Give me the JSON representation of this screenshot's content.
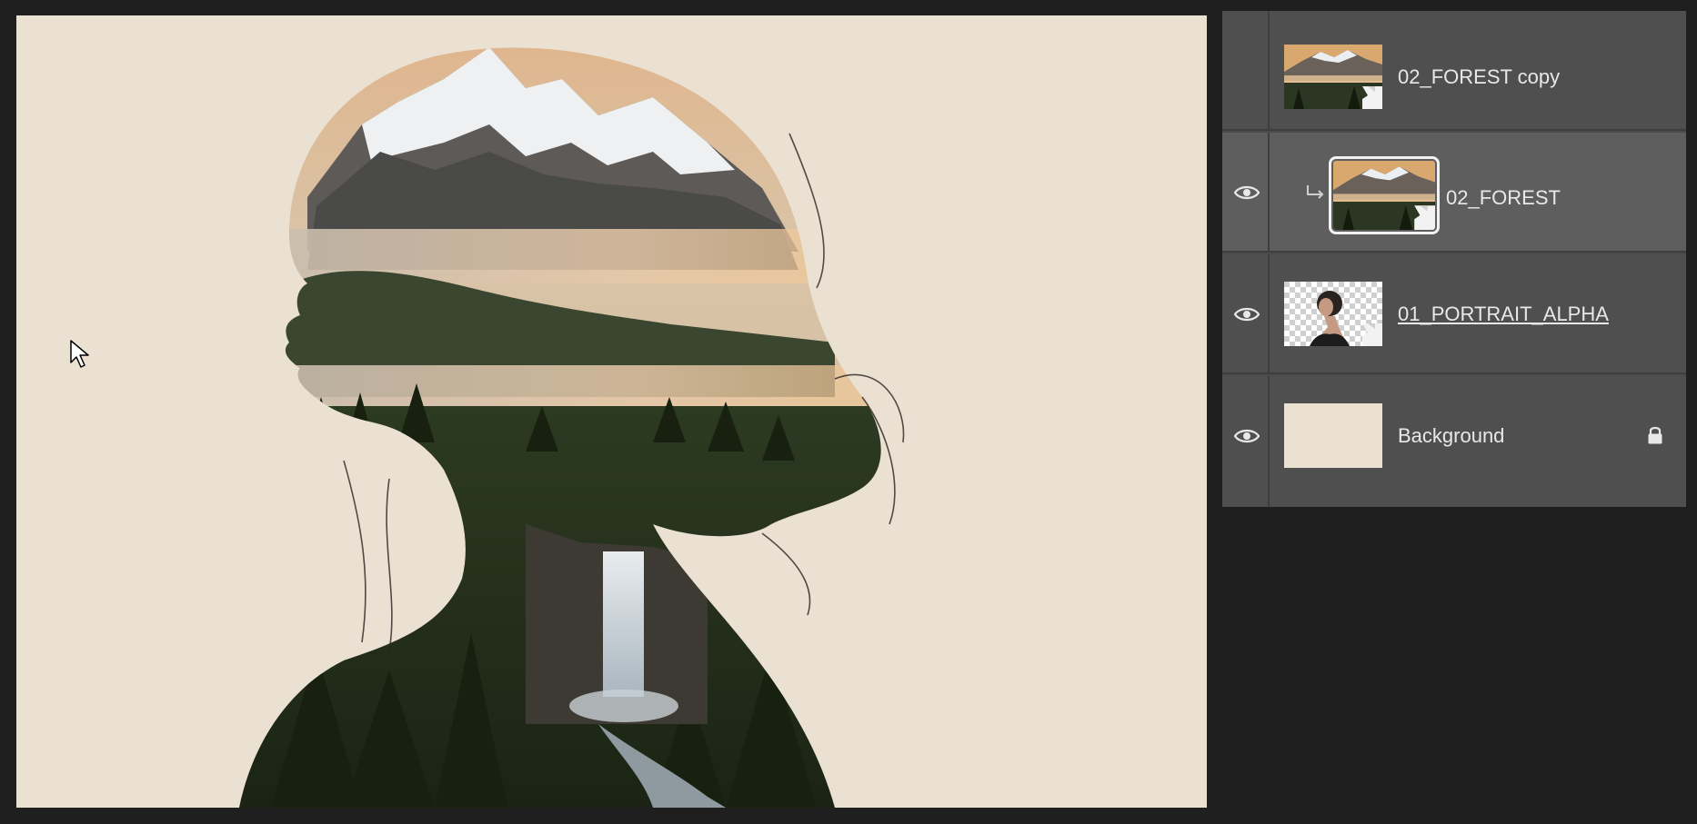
{
  "canvas": {
    "background_color": "#ebe1d2",
    "cursor_icon": "arrow-cursor-icon"
  },
  "layers_panel": {
    "layers": [
      {
        "name": "02_FOREST copy",
        "visible": false,
        "selected": false,
        "clipped": false,
        "locked": false,
        "thumb": "forest"
      },
      {
        "name": "02_FOREST",
        "visible": true,
        "selected": true,
        "clipped": true,
        "locked": false,
        "thumb": "forest"
      },
      {
        "name": "01_PORTRAIT_ALPHA",
        "visible": true,
        "selected": false,
        "clipped": false,
        "locked": false,
        "thumb": "portrait"
      },
      {
        "name": "Background",
        "visible": true,
        "selected": false,
        "clipped": false,
        "locked": true,
        "thumb": "solid"
      }
    ]
  },
  "colors": {
    "panel_bg": "#4f4f4f",
    "panel_selected_bg": "#5e5e5e",
    "app_bg": "#1f1f1f",
    "text": "#e8e8e8"
  }
}
